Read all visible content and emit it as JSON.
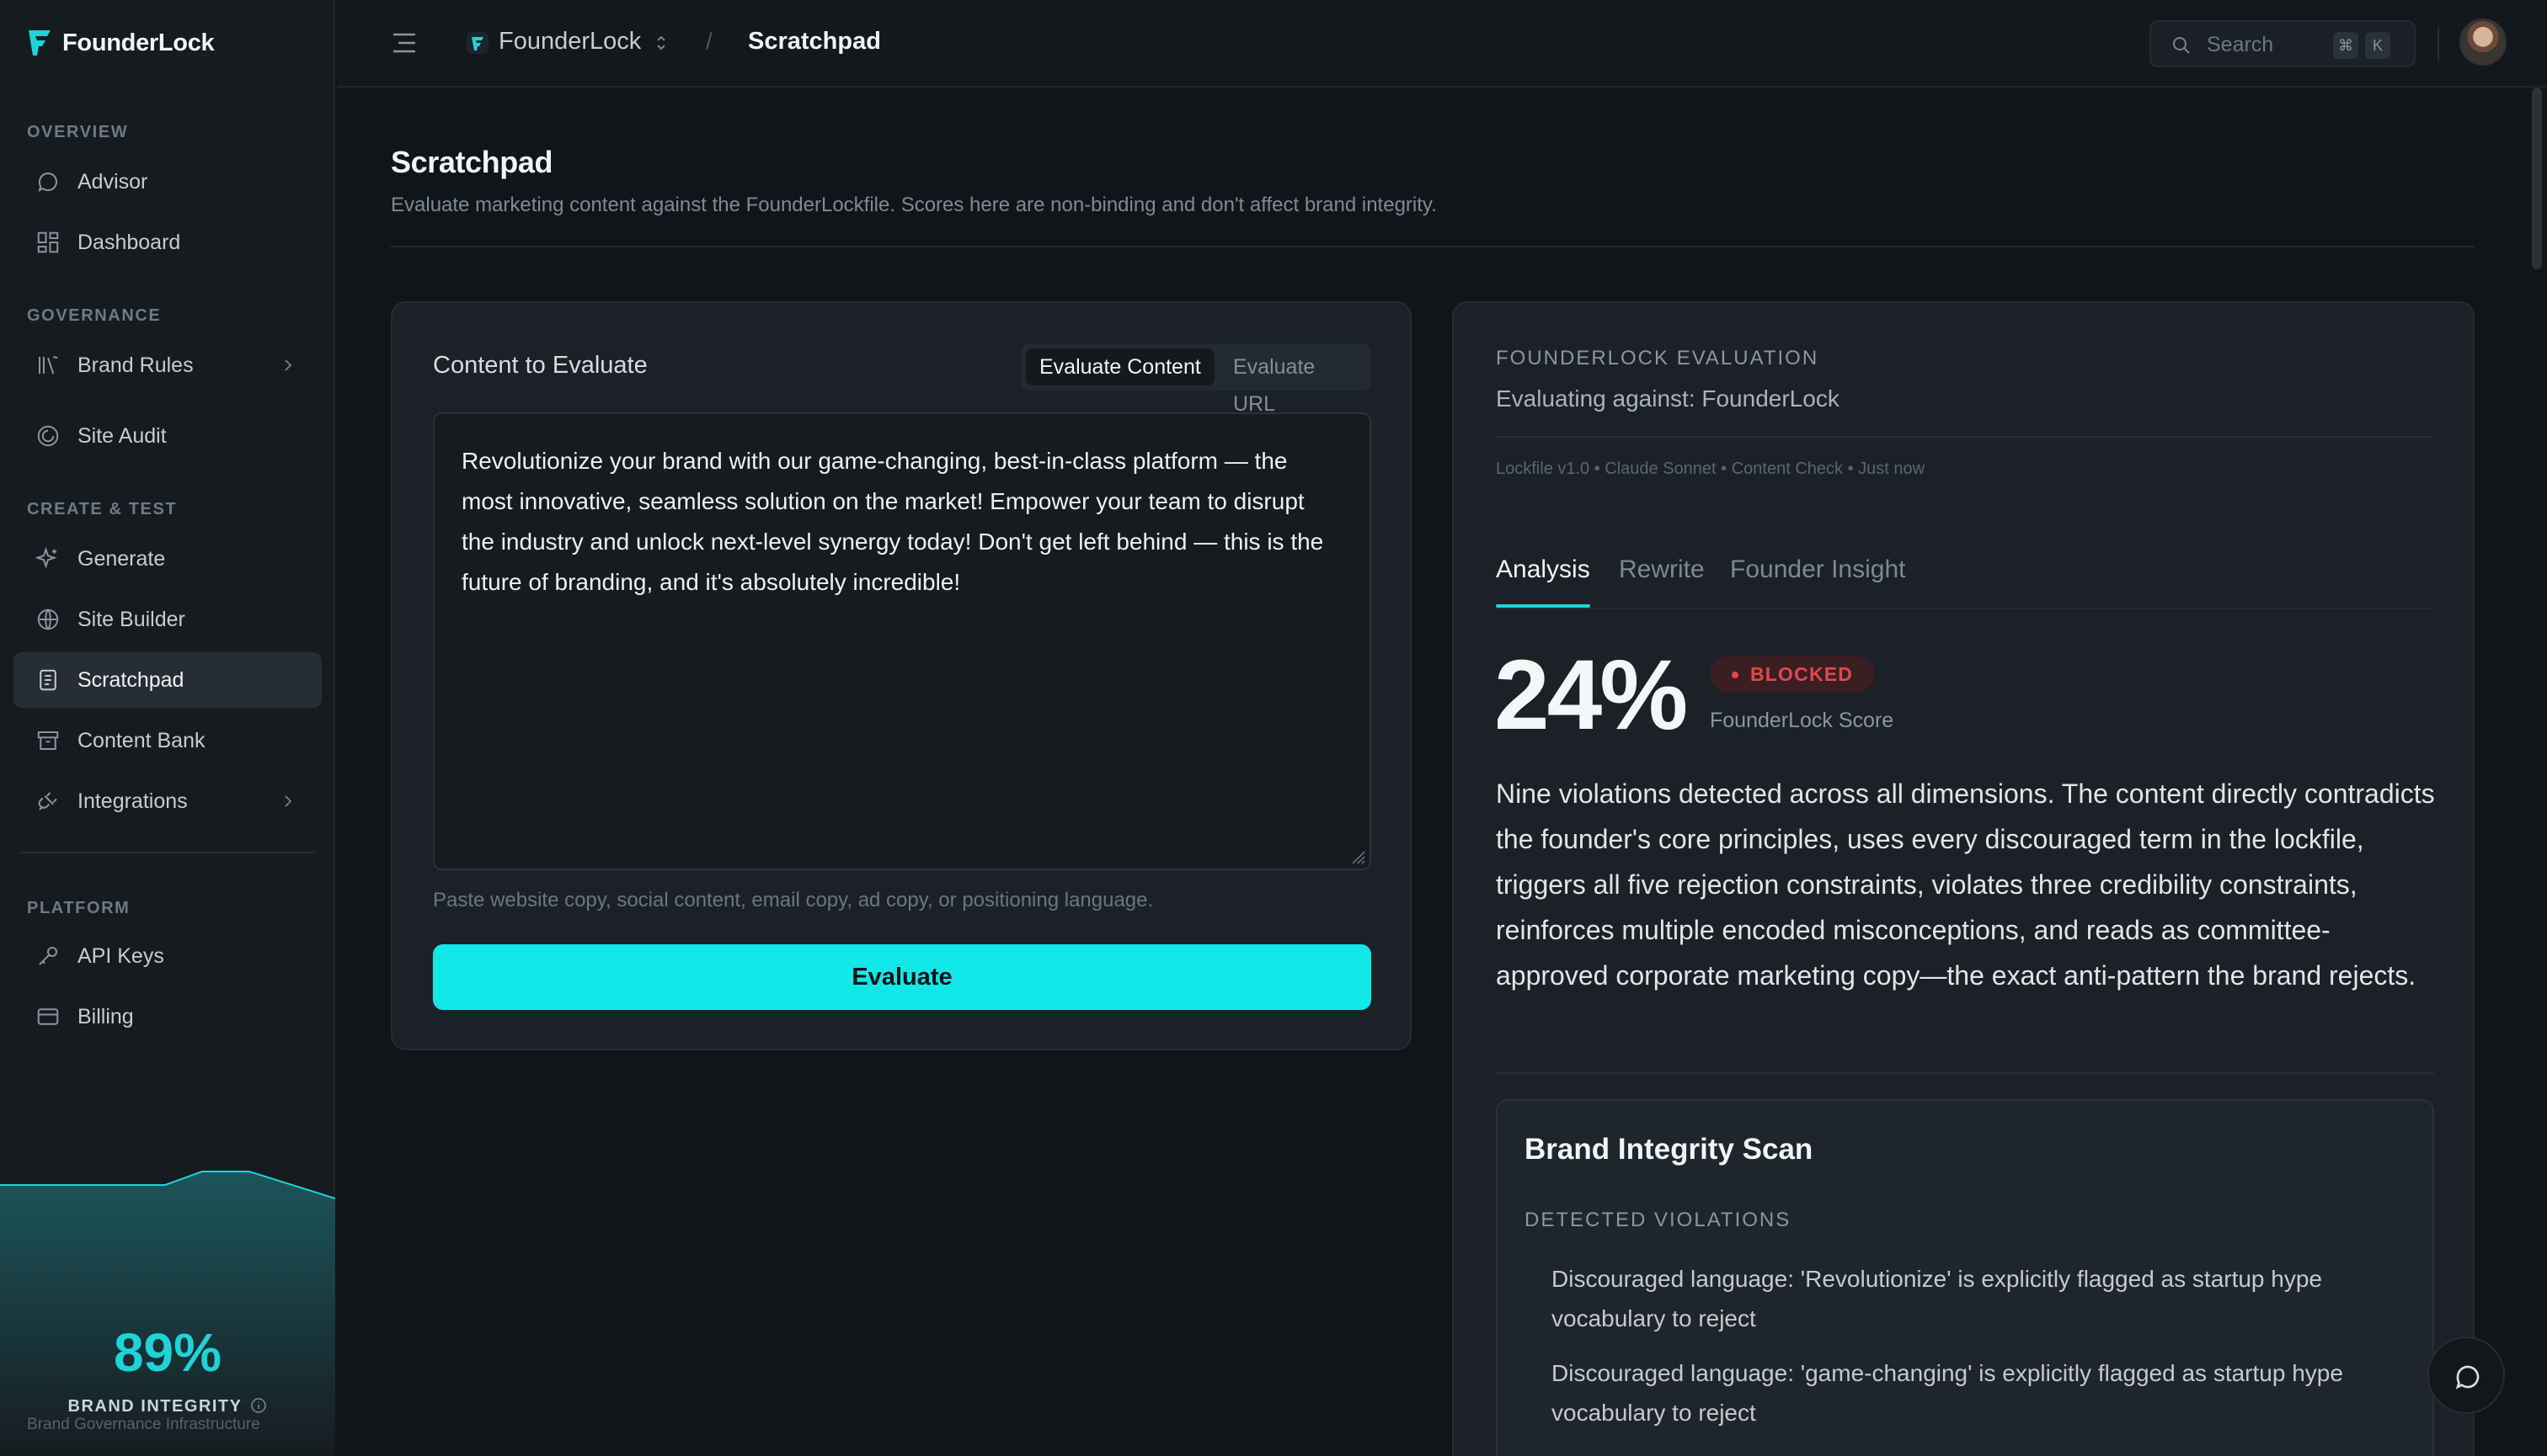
{
  "app": {
    "name": "FounderLock"
  },
  "sidebar": {
    "sections": [
      {
        "label": "OVERVIEW"
      },
      {
        "label": "GOVERNANCE"
      },
      {
        "label": "CREATE & TEST"
      },
      {
        "label": "PLATFORM"
      }
    ],
    "items": [
      {
        "label": "Advisor",
        "icon": "chat-bubble-icon"
      },
      {
        "label": "Dashboard",
        "icon": "grid-icon"
      },
      {
        "label": "Brand Rules",
        "icon": "book-icon"
      },
      {
        "label": "Site Audit",
        "icon": "target-icon"
      },
      {
        "label": "Generate",
        "icon": "sparkle-icon"
      },
      {
        "label": "Site Builder",
        "icon": "globe-icon"
      },
      {
        "label": "Scratchpad",
        "icon": "document-icon",
        "active": true
      },
      {
        "label": "Content Bank",
        "icon": "archive-icon"
      },
      {
        "label": "Integrations",
        "icon": "plug-icon"
      },
      {
        "label": "API Keys",
        "icon": "key-icon"
      },
      {
        "label": "Billing",
        "icon": "card-icon"
      }
    ],
    "integrity": {
      "value": "89%",
      "label": "BRAND INTEGRITY",
      "fraction": 0.89
    },
    "footer": "Brand Governance Infrastructure"
  },
  "topbar": {
    "org": "FounderLock",
    "separator": "/",
    "page": "Scratchpad",
    "search_placeholder": "Search",
    "shortcut": [
      "⌘",
      "K"
    ]
  },
  "page": {
    "title": "Scratchpad",
    "subtitle": "Evaluate marketing content against the FounderLockfile. Scores here are non-binding and don't affect brand integrity."
  },
  "input_card": {
    "title": "Content to Evaluate",
    "modes": [
      "Evaluate Content",
      "Evaluate URL"
    ],
    "active_mode": "Evaluate Content",
    "content": "Revolutionize your brand with our game-changing, best-in-class platform — the most innovative, seamless solution on the market! Empower your team to disrupt the industry and unlock next-level synergy today! Don't get left behind — this is the future of branding, and it's absolutely incredible!",
    "hint": "Paste website copy, social content, email copy, ad copy, or positioning language.",
    "button": "Evaluate"
  },
  "evaluation": {
    "eyebrow": "FOUNDERLOCK EVALUATION",
    "against": "Evaluating against: FounderLock",
    "meta": "Lockfile v1.0 • Claude Sonnet • Content Check • Just now",
    "tabs": [
      "Analysis",
      "Rewrite",
      "Founder Insight"
    ],
    "active_tab": "Analysis",
    "score": "24%",
    "status": "BLOCKED",
    "score_label": "FounderLock Score",
    "summary": "Nine violations detected across all dimensions. The content directly contradicts the founder's core principles, uses every discouraged term in the lockfile, triggers all five rejection constraints, violates three credibility constraints, reinforces multiple encoded misconceptions, and reads as committee-approved corporate marketing copy—the exact anti-pattern the brand rejects.",
    "scan": {
      "title": "Brand Integrity Scan",
      "subtitle": "DETECTED VIOLATIONS",
      "violations": [
        "Discouraged language: 'Revolutionize' is explicitly flagged as startup hype vocabulary to reject",
        "Discouraged language: 'game-changing' is explicitly flagged as startup hype vocabulary to reject"
      ]
    }
  },
  "colors": {
    "accent": "#12e8e8",
    "danger": "#e2484f",
    "background": "#111519"
  }
}
